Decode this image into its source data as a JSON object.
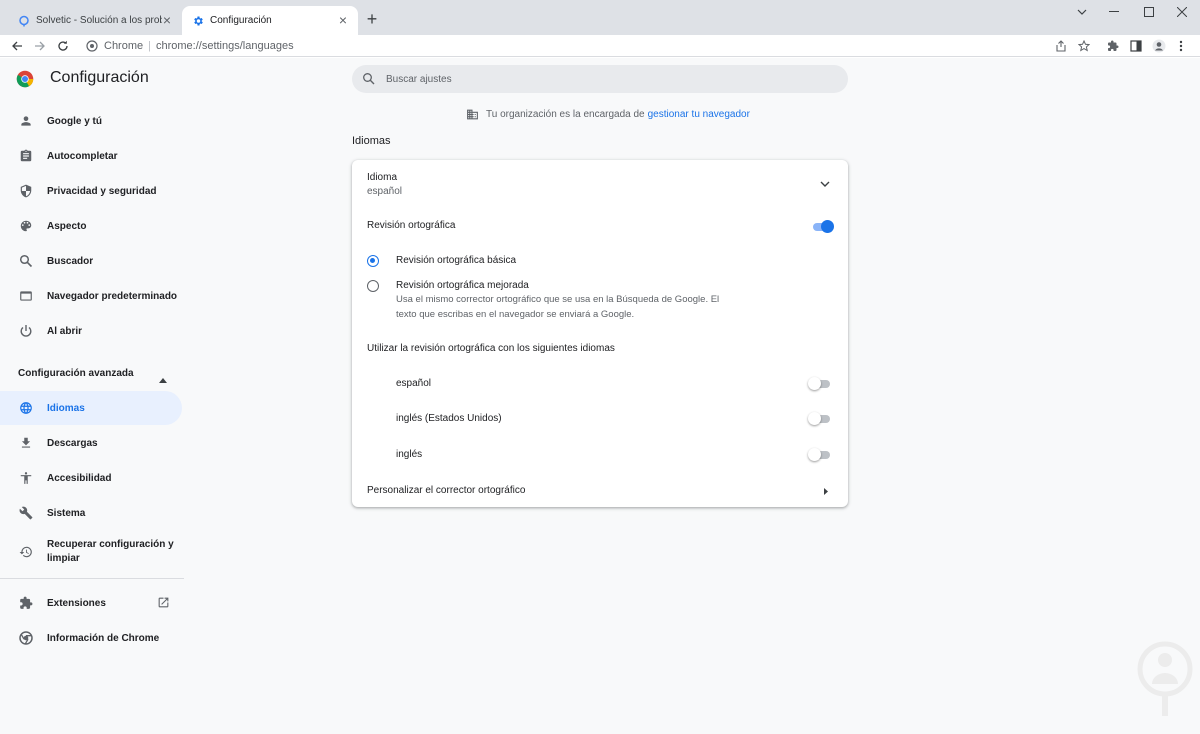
{
  "browser": {
    "tabs": [
      {
        "title": "Solvetic - Solución a los problemas",
        "active": false
      },
      {
        "title": "Configuración",
        "active": true
      }
    ],
    "omnibox": {
      "site_label": "Chrome",
      "url": "chrome://settings/languages"
    }
  },
  "header": {
    "title": "Configuración"
  },
  "search": {
    "placeholder": "Buscar ajustes"
  },
  "sidebar": {
    "items": [
      {
        "label": "Google y tú",
        "icon": "person-icon"
      },
      {
        "label": "Autocompletar",
        "icon": "clipboard-icon"
      },
      {
        "label": "Privacidad y seguridad",
        "icon": "shield-icon"
      },
      {
        "label": "Aspecto",
        "icon": "palette-icon"
      },
      {
        "label": "Buscador",
        "icon": "search-icon"
      },
      {
        "label": "Navegador predeterminado",
        "icon": "browser-icon"
      },
      {
        "label": "Al abrir",
        "icon": "power-icon"
      }
    ],
    "advanced_label": "Configuración avanzada",
    "advanced_items": [
      {
        "label": "Idiomas",
        "icon": "globe-icon",
        "active": true
      },
      {
        "label": "Descargas",
        "icon": "download-icon"
      },
      {
        "label": "Accesibilidad",
        "icon": "accessibility-icon"
      },
      {
        "label": "Sistema",
        "icon": "wrench-icon"
      },
      {
        "label_line1": "Recuperar configuración y",
        "label_line2": "limpiar",
        "icon": "restore-icon"
      }
    ],
    "extensions_label": "Extensiones",
    "about_label": "Información de Chrome"
  },
  "managed": {
    "text": "Tu organización es la encargada de",
    "link": "gestionar tu navegador"
  },
  "main": {
    "section_title": "Idiomas",
    "language": {
      "label": "Idioma",
      "value": "español"
    },
    "spellcheck": {
      "label": "Revisión ortográfica",
      "enabled": true,
      "basic_label": "Revisión ortográfica básica",
      "basic_selected": true,
      "enhanced_label": "Revisión ortográfica mejorada",
      "enhanced_desc_line1": "Usa el mismo corrector ortográfico que se usa en la Búsqueda de Google. El",
      "enhanced_desc_line2": "texto que escribas en el navegador se enviará a Google."
    },
    "languages_heading": "Utilizar la revisión ortográfica con los siguientes idiomas",
    "languages": [
      {
        "name": "español",
        "enabled": false
      },
      {
        "name": "inglés (Estados Unidos)",
        "enabled": false
      },
      {
        "name": "inglés",
        "enabled": false
      }
    ],
    "customize_label": "Personalizar el corrector ortográfico"
  },
  "colors": {
    "accent": "#1a73e8",
    "active_bg": "#e8f0fe",
    "page_bg": "#f8f9fa"
  }
}
